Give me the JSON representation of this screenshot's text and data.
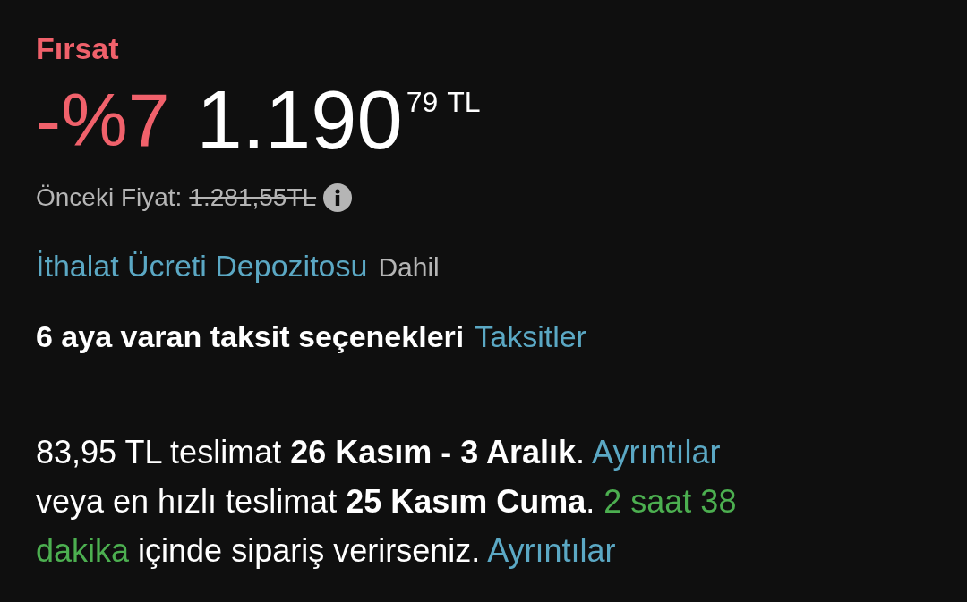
{
  "deal_badge": "Fırsat",
  "price": {
    "discount": "-%7",
    "whole": "1.190",
    "fraction": "79",
    "currency": "TL"
  },
  "previous_price": {
    "label": "Önceki Fiyat:",
    "value": "1.281,55TL"
  },
  "import_fee": {
    "link": "İthalat Ücreti Depozitosu",
    "note": "Dahil"
  },
  "installments": {
    "text": "6 aya varan taksit seçenekleri",
    "link": "Taksitler"
  },
  "delivery": [
    {
      "kind": "text",
      "text": "83,95 TL teslimat "
    },
    {
      "kind": "bold",
      "text": "26 Kasım - 3 Aralık"
    },
    {
      "kind": "text",
      "text": ". "
    },
    {
      "kind": "link",
      "text": "Ayrıntılar"
    },
    {
      "kind": "text",
      "text": " veya en hızlı teslimat "
    },
    {
      "kind": "bold",
      "text": "25 Kasım Cuma"
    },
    {
      "kind": "text",
      "text": ". "
    },
    {
      "kind": "highlight",
      "text": "2 saat 38 dakika"
    },
    {
      "kind": "text",
      "text": " içinde sipariş verirseniz. "
    },
    {
      "kind": "link",
      "text": "Ayrıntılar"
    }
  ]
}
